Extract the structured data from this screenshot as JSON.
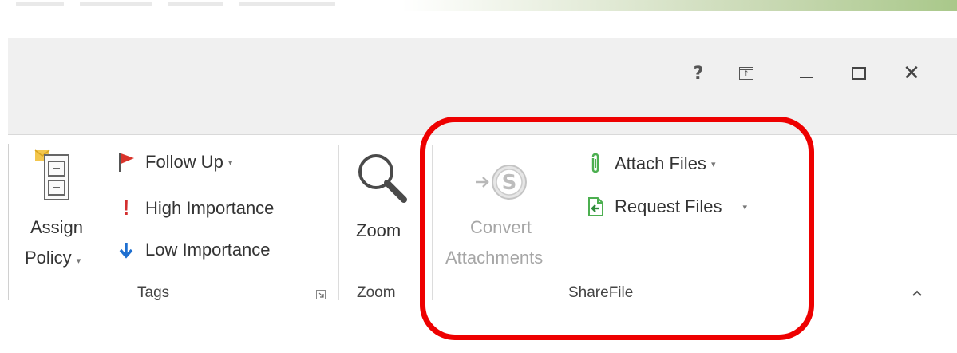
{
  "window": {
    "help": "?",
    "minimize_label": "minimize",
    "maximize_label": "maximize",
    "close": "✕"
  },
  "ribbon": {
    "tags_group": {
      "assign_policy": [
        "Assign",
        "Policy"
      ],
      "follow_up": "Follow Up",
      "high_importance": "High Importance",
      "low_importance": "Low Importance",
      "label": "Tags"
    },
    "zoom_group": {
      "zoom_button": "Zoom",
      "label": "Zoom"
    },
    "sharefile_group": {
      "convert_attachments": [
        "Convert",
        "Attachments"
      ],
      "attach_files": "Attach Files",
      "request_files": "Request Files",
      "label": "ShareFile"
    },
    "collapse": "^"
  },
  "colors": {
    "highlight": "#ee0000",
    "follow_up_flag": "#c0392b",
    "high_importance": "#d32f2f",
    "low_importance": "#1e6fd0",
    "sharefile_green": "#4caf50"
  }
}
